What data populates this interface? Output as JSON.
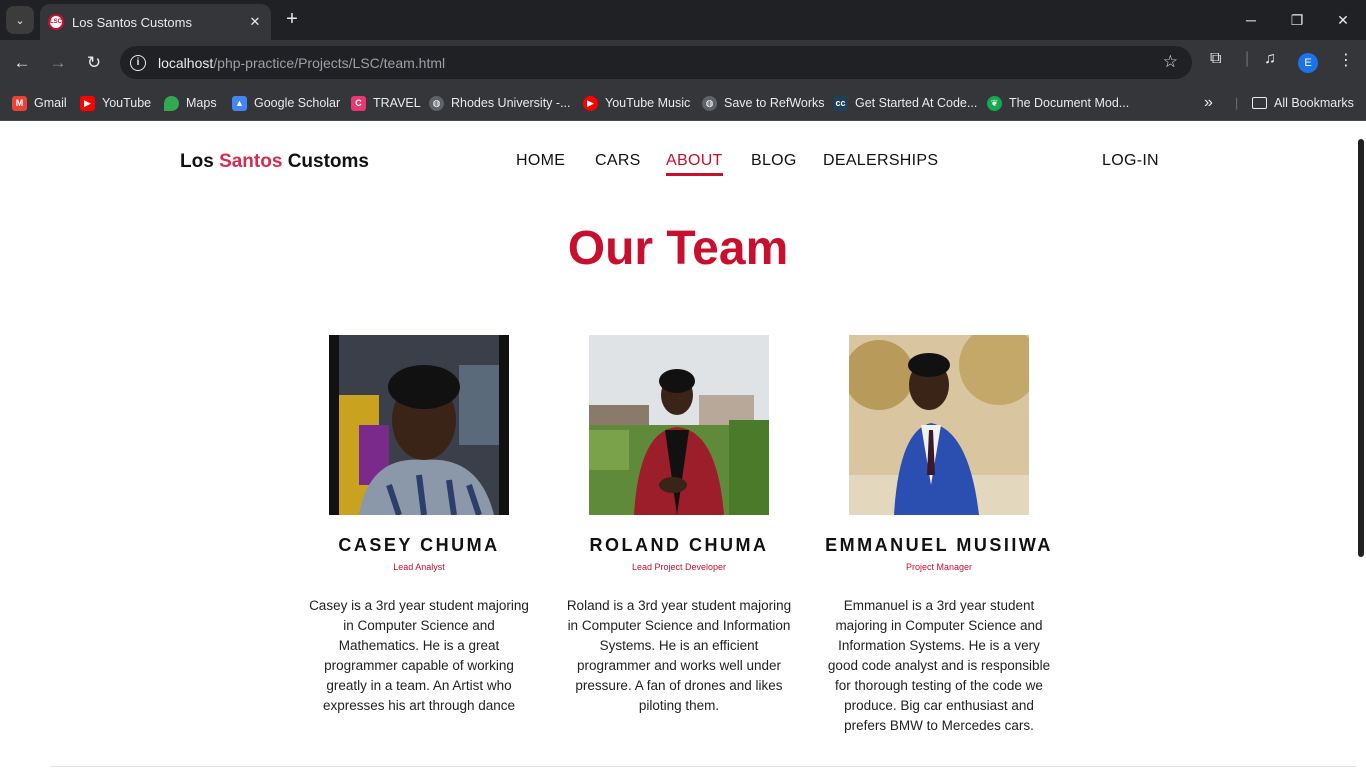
{
  "browser": {
    "tab_search_icon": "chevron-down-icon",
    "tab": {
      "favicon_text": "LSC",
      "title": "Los Santos Customs",
      "close": "✕"
    },
    "new_tab": "+",
    "window": {
      "minimize": "─",
      "restore": "❐",
      "close": "✕"
    },
    "url_host": "localhost",
    "url_path": "/php-practice/Projects/LSC/team.html",
    "profile_initial": "E",
    "bookmarks": [
      {
        "label": "Gmail",
        "icon": "gmail-icon",
        "color": "#ea4335",
        "glyph": "M"
      },
      {
        "label": "YouTube",
        "icon": "youtube-icon",
        "color": "#ff0000",
        "glyph": "▶"
      },
      {
        "label": "Maps",
        "icon": "maps-icon",
        "color": "#34a853",
        "glyph": "⬤"
      },
      {
        "label": "Google Scholar",
        "icon": "scholar-icon",
        "color": "#4285f4",
        "glyph": "▲"
      },
      {
        "label": "TRAVEL",
        "icon": "travel-icon",
        "color": "#e6396f",
        "glyph": "C"
      },
      {
        "label": "Rhodes University -...",
        "icon": "globe-icon",
        "color": "#5f6368",
        "glyph": "◍"
      },
      {
        "label": "YouTube Music",
        "icon": "youtube-music-icon",
        "color": "#ff0000",
        "glyph": "▶"
      },
      {
        "label": "Save to RefWorks",
        "icon": "globe-icon",
        "color": "#5f6368",
        "glyph": "◍"
      },
      {
        "label": "Get Started At Code...",
        "icon": "codecademy-icon",
        "color": "#1f4056",
        "glyph": "cc"
      },
      {
        "label": "The Document Mod...",
        "icon": "mongodb-icon",
        "color": "#13aa52",
        "glyph": "❦"
      }
    ],
    "all_bookmarks": "All Bookmarks"
  },
  "site": {
    "brand": {
      "part1": "Los ",
      "accent": "Santos",
      "part2": " Customs"
    },
    "nav": [
      "HOME",
      "CARS",
      "ABOUT",
      "BLOG",
      "DEALERSHIPS"
    ],
    "login": "LOG-IN",
    "title": "Our Team",
    "members": [
      {
        "name": "CASEY CHUMA",
        "role": "Lead Analyst",
        "bio": "Casey is a 3rd year student majoring in Computer Science and Mathematics. He is a great programmer capable of working greatly in a team. An Artist who expresses his art through dance"
      },
      {
        "name": "ROLAND CHUMA",
        "role": "Lead Project Developer",
        "bio": "Roland is a 3rd year student majoring in Computer Science and Information Systems. He is an efficient programmer and works well under pressure. A fan of drones and likes piloting them."
      },
      {
        "name": "EMMANUEL MUSIIWA",
        "role": "Project Manager",
        "bio": "Emmanuel is a 3rd year student majoring in Computer Science and Information Systems. He is a very good code analyst and is responsible for thorough testing of the code we produce. Big car enthusiast and prefers BMW to Mercedes cars."
      }
    ]
  },
  "colors": {
    "accent": "#c8102e",
    "brand_accent": "#d62d4f",
    "chrome_dark": "#202124",
    "chrome": "#35363a"
  }
}
